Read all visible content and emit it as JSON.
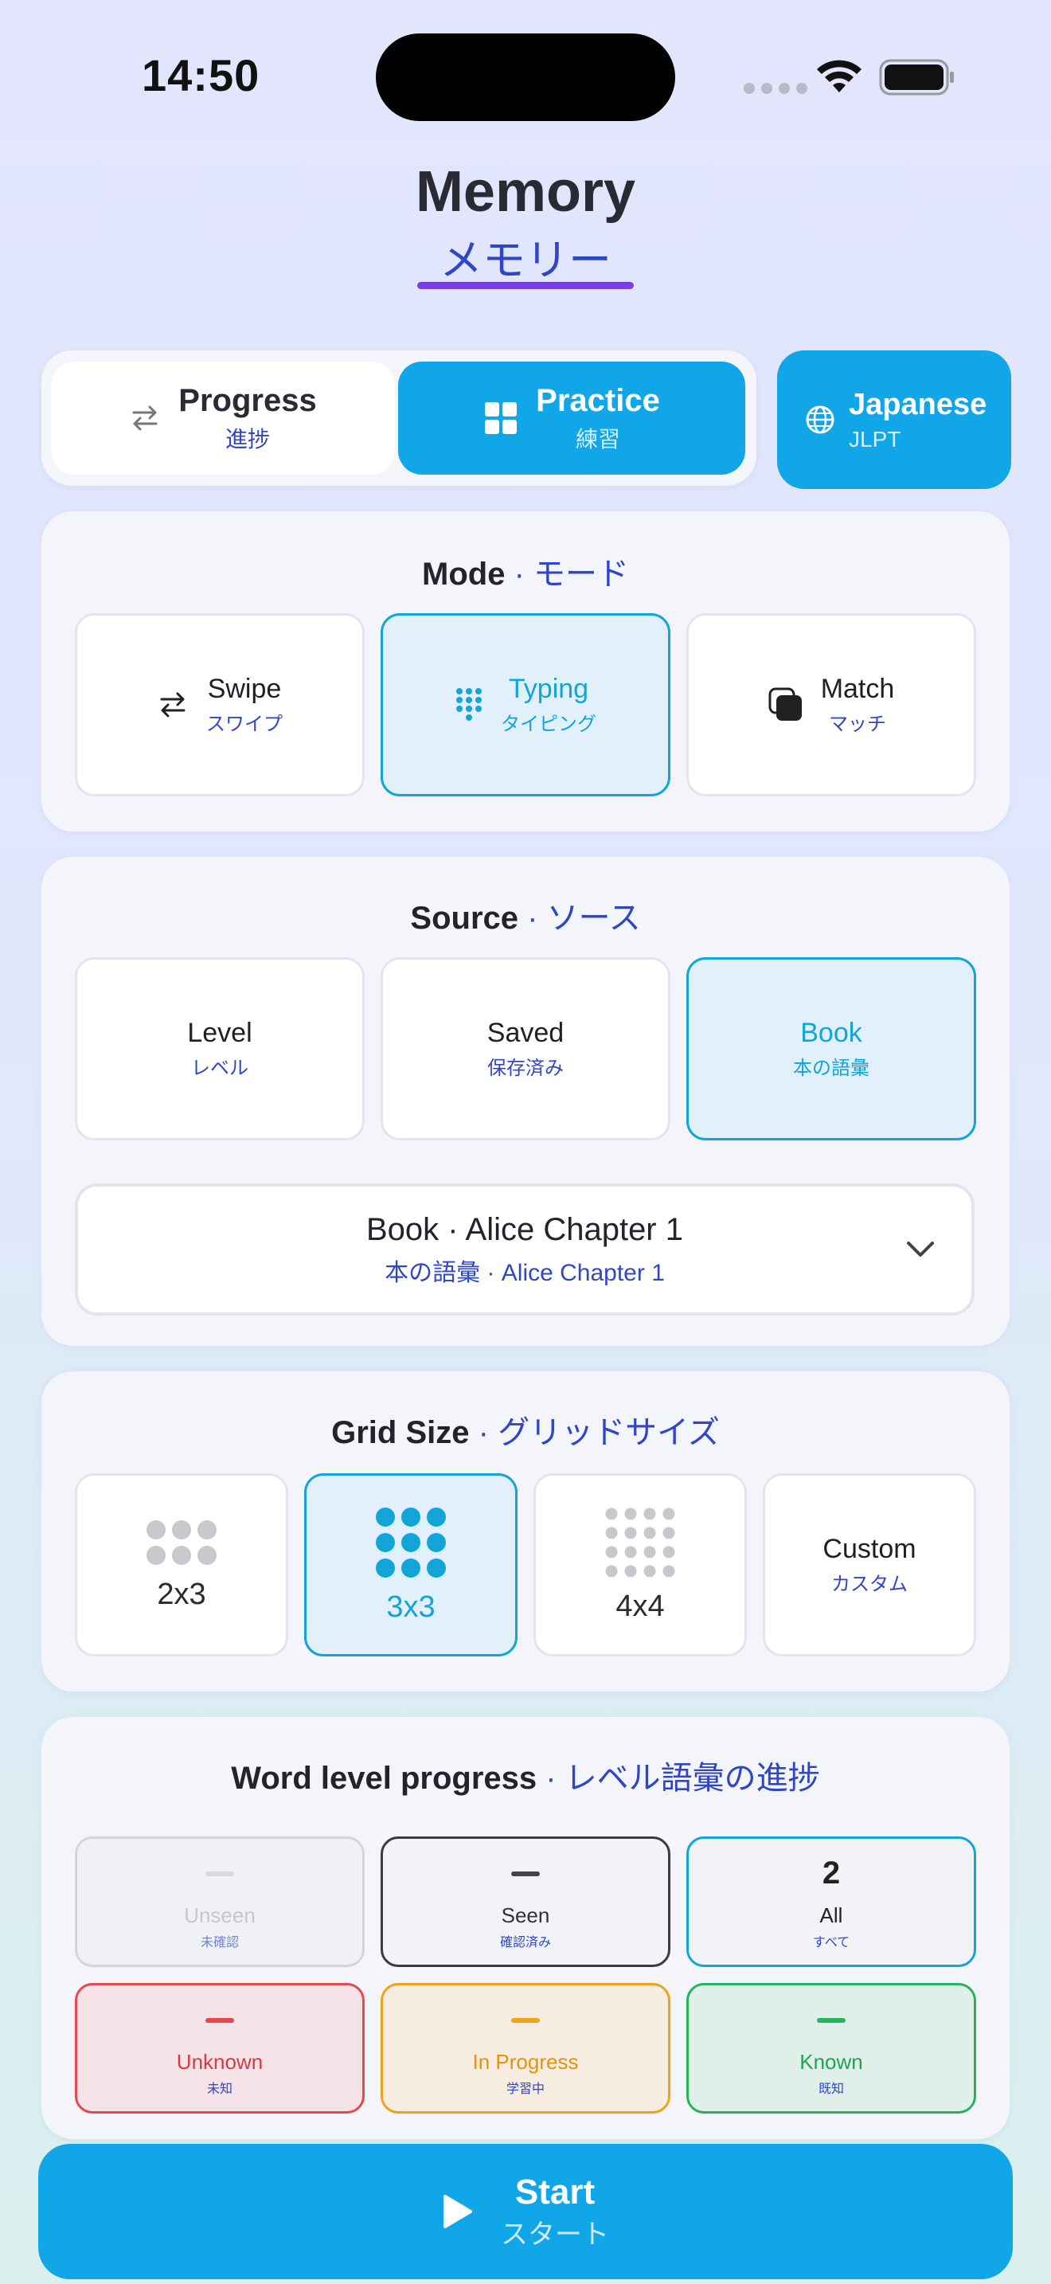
{
  "status_bar": {
    "time": "14:50"
  },
  "header": {
    "title": "Memory",
    "subtitle": "メモリー"
  },
  "tabs": {
    "progress": {
      "label": "Progress",
      "sub": "進捗"
    },
    "practice": {
      "label": "Practice",
      "sub": "練習"
    }
  },
  "language": {
    "label": "Japanese",
    "sub": "JLPT"
  },
  "mode": {
    "title": "Mode",
    "title_jp": "· モード",
    "options": [
      {
        "label": "Swipe",
        "sub": "スワイプ"
      },
      {
        "label": "Typing",
        "sub": "タイピング"
      },
      {
        "label": "Match",
        "sub": "マッチ"
      }
    ],
    "selected": "Typing"
  },
  "source": {
    "title": "Source",
    "title_jp": "· ソース",
    "options": [
      {
        "label": "Level",
        "sub": "レベル"
      },
      {
        "label": "Saved",
        "sub": "保存済み"
      },
      {
        "label": "Book",
        "sub": "本の語彙"
      }
    ],
    "selected": "Book",
    "dropdown": {
      "label": "Book · Alice Chapter 1",
      "sub": "本の語彙 · Alice Chapter 1"
    }
  },
  "grid_size": {
    "title": "Grid Size",
    "title_jp": "· グリッドサイズ",
    "options": [
      {
        "label": "2x3"
      },
      {
        "label": "3x3"
      },
      {
        "label": "4x4"
      },
      {
        "label": "Custom",
        "sub": "カスタム"
      }
    ],
    "selected": "3x3"
  },
  "word_progress": {
    "title": "Word level progress",
    "title_jp": "· レベル語彙の進捗",
    "items": [
      {
        "value": "—",
        "label": "Unseen",
        "sub": "未確認"
      },
      {
        "value": "—",
        "label": "Seen",
        "sub": "確認済み"
      },
      {
        "value": "2",
        "label": "All",
        "sub": "すべて"
      },
      {
        "value": "—",
        "label": "Unknown",
        "sub": "未知"
      },
      {
        "value": "—",
        "label": "In Progress",
        "sub": "学習中"
      },
      {
        "value": "—",
        "label": "Known",
        "sub": "既知"
      }
    ]
  },
  "start": {
    "label": "Start",
    "sub": "スタート"
  },
  "colors": {
    "accent": "#10a6e8",
    "jp_text": "#2f47c7",
    "underline": "#7a3fe0",
    "selected_border": "#12a5d9"
  }
}
